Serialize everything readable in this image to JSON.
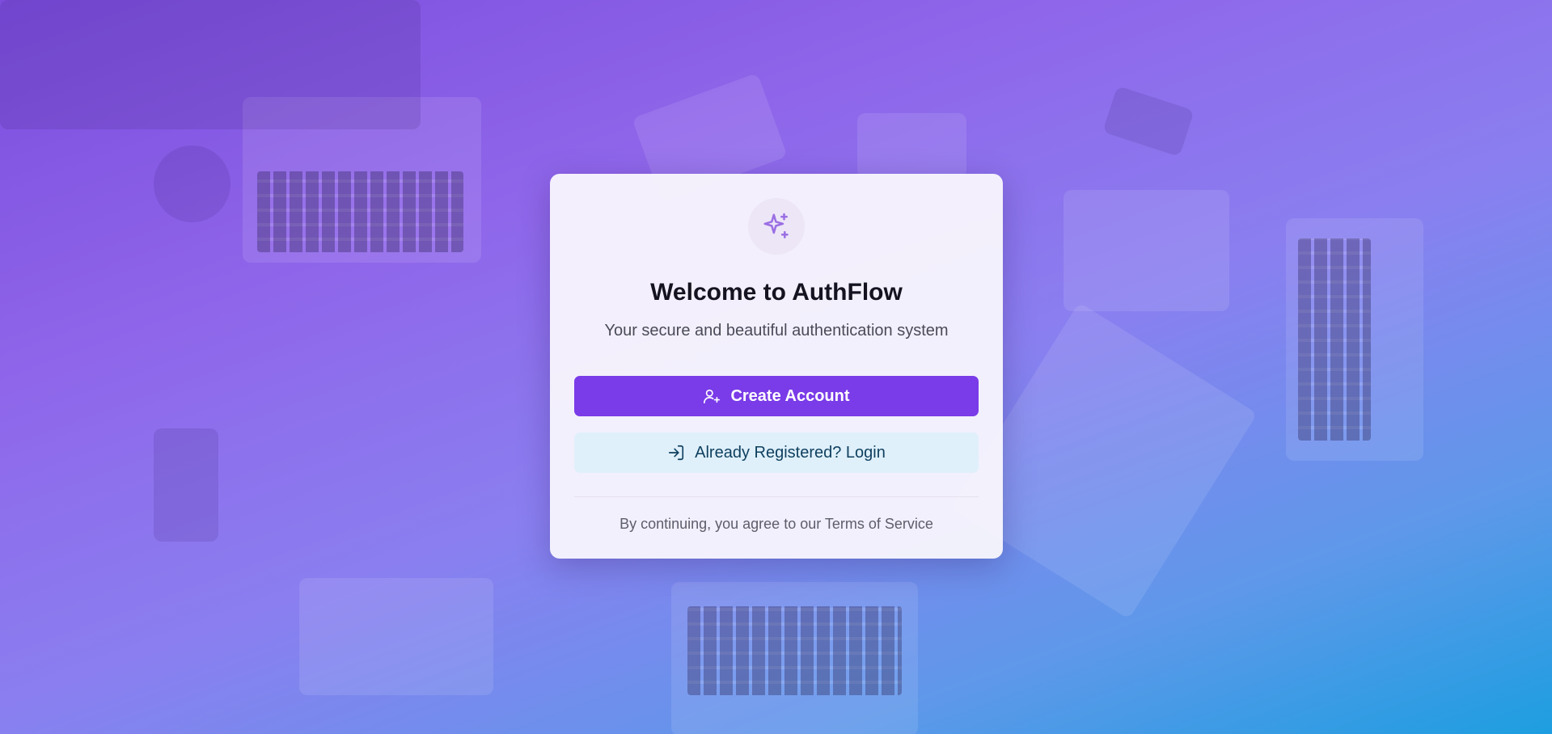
{
  "card": {
    "logo_icon": "sparkles-icon",
    "title": "Welcome to AuthFlow",
    "subtitle": "Your secure and beautiful authentication system",
    "primary_button": {
      "label": "Create Account",
      "icon": "user-plus-icon"
    },
    "secondary_button": {
      "label": "Already Registered? Login",
      "icon": "log-in-icon"
    },
    "terms_text": "By continuing, you agree to our Terms of Service"
  },
  "colors": {
    "accent": "#7a3be8",
    "secondary_bg": "#dff0fb",
    "icon_purple": "#9b6fe3"
  }
}
